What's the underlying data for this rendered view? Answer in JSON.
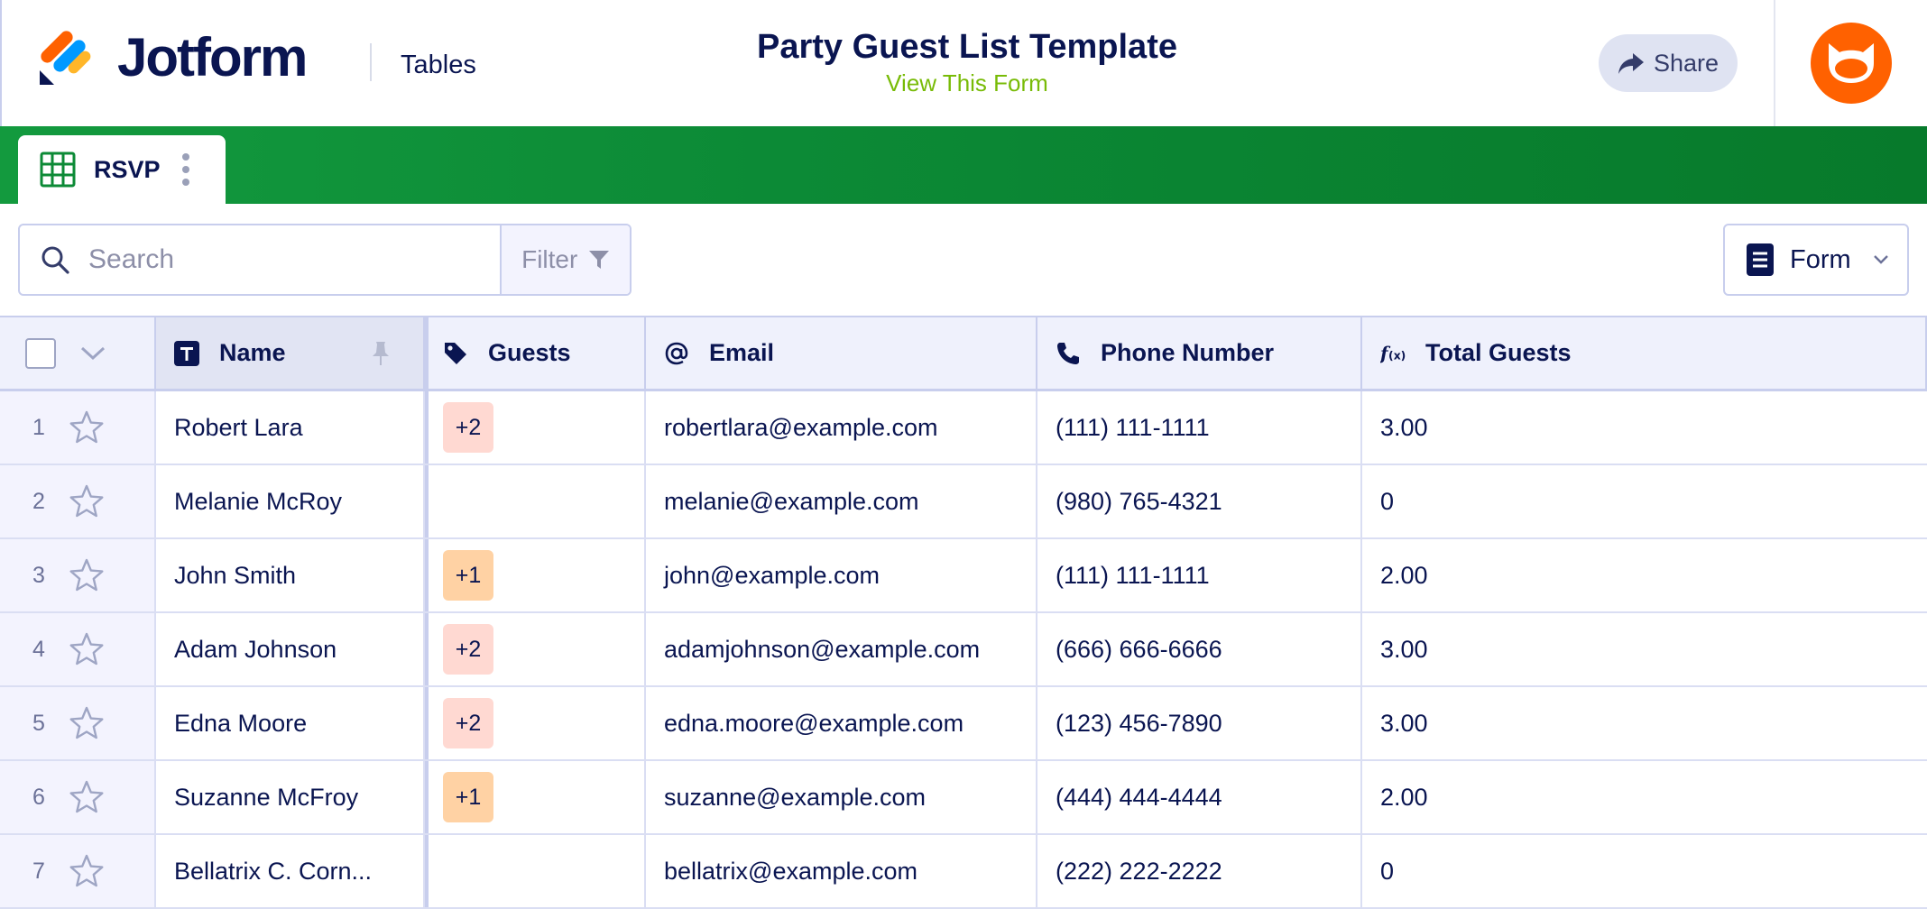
{
  "header": {
    "brand": "Jotform",
    "product": "Tables",
    "title": "Party Guest List Template",
    "subtitle": "View This Form",
    "share_label": "Share"
  },
  "tabs": [
    {
      "label": "RSVP",
      "icon": "grid-table-icon"
    }
  ],
  "toolbar": {
    "search_placeholder": "Search",
    "filter_label": "Filter",
    "form_label": "Form"
  },
  "columns": {
    "name": "Name",
    "guests": "Guests",
    "email": "Email",
    "phone": "Phone Number",
    "total": "Total Guests"
  },
  "rows": [
    {
      "num": "1",
      "name": "Robert Lara",
      "guests": "+2",
      "email": "robertlara@example.com",
      "phone": "(111) 111-1111",
      "total": "3.00"
    },
    {
      "num": "2",
      "name": "Melanie McRoy",
      "guests": "",
      "email": "melanie@example.com",
      "phone": "(980) 765-4321",
      "total": "0"
    },
    {
      "num": "3",
      "name": "John Smith",
      "guests": "+1",
      "email": "john@example.com",
      "phone": "(111) 111-1111",
      "total": "2.00"
    },
    {
      "num": "4",
      "name": "Adam Johnson",
      "guests": "+2",
      "email": "adamjohnson@example.com",
      "phone": "(666) 666-6666",
      "total": "3.00"
    },
    {
      "num": "5",
      "name": "Edna Moore",
      "guests": "+2",
      "email": "edna.moore@example.com",
      "phone": "(123) 456-7890",
      "total": "3.00"
    },
    {
      "num": "6",
      "name": "Suzanne McFroy",
      "guests": "+1",
      "email": "suzanne@example.com",
      "phone": "(444) 444-4444",
      "total": "2.00"
    },
    {
      "num": "7",
      "name": "Bellatrix C. Corn...",
      "guests": "",
      "email": "bellatrix@example.com",
      "phone": "(222) 222-2222",
      "total": "0"
    }
  ],
  "colors": {
    "accent_green": "#0c8a36",
    "navy": "#0a1551",
    "subtitle_green": "#78bb07",
    "avatar_orange": "#ff6100",
    "badge_plus2": "#ffd9d2",
    "badge_plus1": "#ffd2a4"
  }
}
